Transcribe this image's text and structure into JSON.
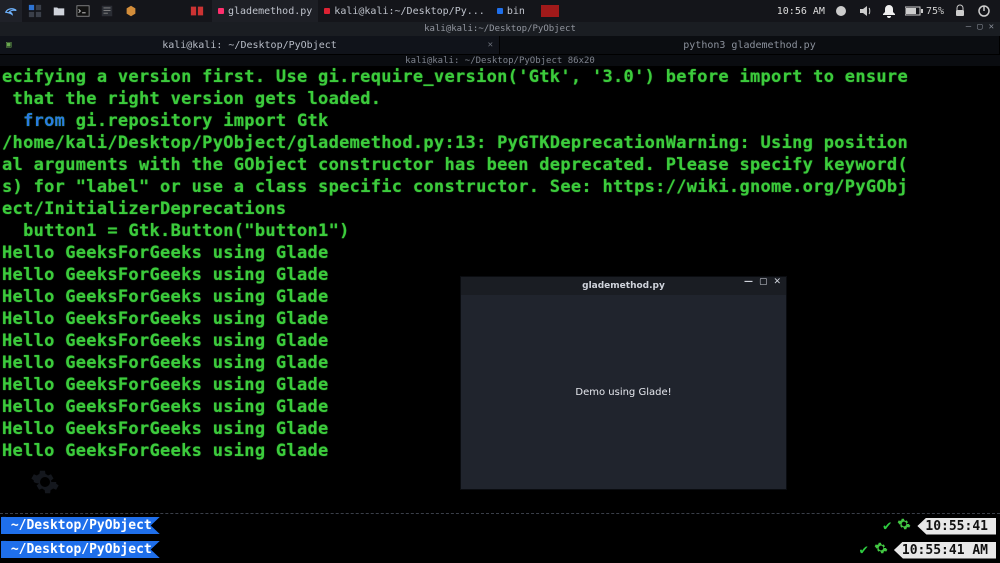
{
  "panel": {
    "tasks": [
      {
        "label": "glademethod.py",
        "dot": "pink",
        "active": true
      },
      {
        "label": "kali@kali:~/Desktop/Py...",
        "dot": "red",
        "active": false
      },
      {
        "label": "bin",
        "dot": "blue",
        "active": false
      },
      {
        "label": "",
        "dot": "dkred",
        "active": false
      }
    ],
    "clock": "10:56 AM",
    "battery": "75%"
  },
  "terminal": {
    "title": "kali@kali:~/Desktop/PyObject",
    "tabs": [
      {
        "label": "kali@kali: ~/Desktop/PyObject",
        "active": true
      },
      {
        "label": "python3 glademethod.py",
        "active": false
      }
    ],
    "columns": "kali@kali: ~/Desktop/PyObject 86x20",
    "lines_plain": "ecifying a version first. Use gi.require_version('Gtk', '3.0') before import to ensure\n that the right version gets loaded.\n",
    "import_kw": "from",
    "import_rest": " gi.repository import Gtk",
    "lines_after": "/home/kali/Desktop/PyObject/glademethod.py:13: PyGTKDeprecationWarning: Using position\nal arguments with the GObject constructor has been deprecated. Please specify keyword(\ns) for \"label\" or use a class specific constructor. See: https://wiki.gnome.org/PyGObj\nect/InitializerDeprecations\n  button1 = Gtk.Button(\"button1\")\nHello GeeksForGeeks using Glade\nHello GeeksForGeeks using Glade\nHello GeeksForGeeks using Glade\nHello GeeksForGeeks using Glade\nHello GeeksForGeeks using Glade\nHello GeeksForGeeks using Glade\nHello GeeksForGeeks using Glade\nHello GeeksForGeeks using Glade\nHello GeeksForGeeks using Glade\nHello GeeksForGeeks using Glade"
  },
  "prompt": {
    "path_prefix": " ~/Desktop/",
    "path_bold": "PyObject ",
    "time1": "10:55:41",
    "time2": "10:55:41 AM"
  },
  "gtk": {
    "title": "glademethod.py",
    "label": "Demo using Glade!"
  }
}
